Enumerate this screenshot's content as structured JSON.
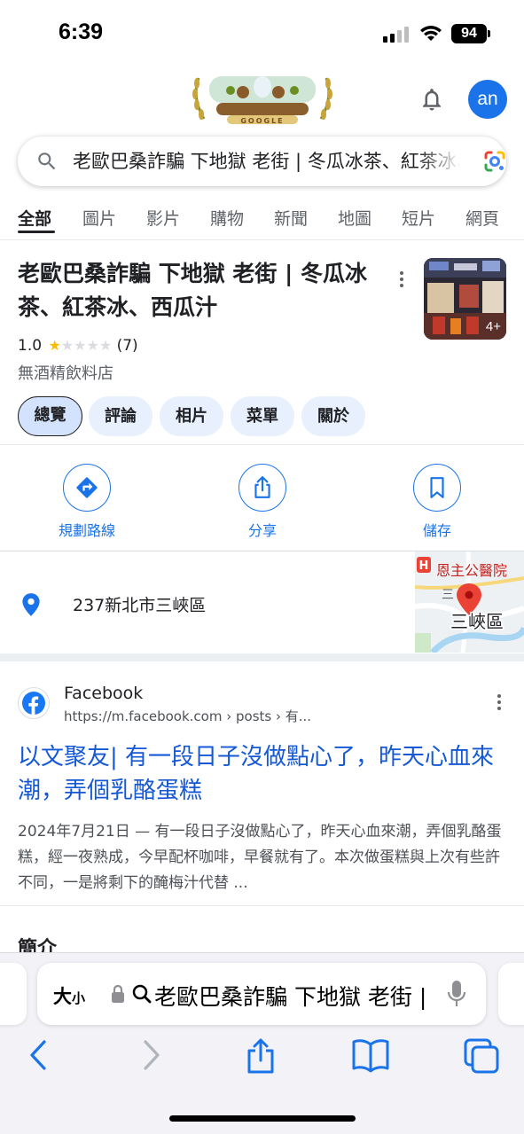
{
  "status_bar": {
    "time": "6:39",
    "battery": "94"
  },
  "header": {
    "avatar_initials": "an",
    "doodle_text": "GOOGLE"
  },
  "search": {
    "query": "老歐巴桑詐騙 下地獄 老街 | 冬瓜冰茶、紅茶冰、西瓜汁"
  },
  "tabs": [
    "全部",
    "圖片",
    "影片",
    "購物",
    "新聞",
    "地圖",
    "短片",
    "網頁"
  ],
  "place": {
    "title": "老歐巴桑詐騙 下地獄 老街 | 冬瓜冰茶、紅茶冰、西瓜汁",
    "rating": "1.0",
    "rating_value": 1,
    "review_count": "(7)",
    "category": "無酒精飲料店",
    "photo_count": "4+",
    "chips": [
      "總覽",
      "評論",
      "相片",
      "菜單",
      "關於"
    ],
    "actions": [
      "規劃路線",
      "分享",
      "儲存"
    ],
    "address": "237新北市三峽區",
    "map_labels": {
      "hospital": "恩主公醫院",
      "district": "三峽區",
      "small": "三"
    }
  },
  "result": {
    "site_name": "Facebook",
    "url": "https://m.facebook.com › posts › 有...",
    "title": "以文聚友| 有一段日子沒做點心了，昨天心血來潮，弄個乳酪蛋糕",
    "snippet": "2024年7月21日 — 有一段日子沒做點心了，昨天心血來潮，弄個乳酪蛋糕，經一夜熟成，今早配杯咖啡，早餐就有了。本次做蛋糕與上次有些許不同，一是將剩下的醃梅汁代替 ..."
  },
  "next_section_heading": "簡介",
  "safari": {
    "text_size_label": "大",
    "text_size_small": "小",
    "address_text": "老歐巴桑詐騙 下地獄 老街 | 冬瓜冰茶、紅茶冰、西瓜汁"
  },
  "colors": {
    "link_blue": "#1558d6",
    "accent_blue": "#1a73e8",
    "star": "#fbbc04",
    "pin_red": "#ea4335"
  }
}
